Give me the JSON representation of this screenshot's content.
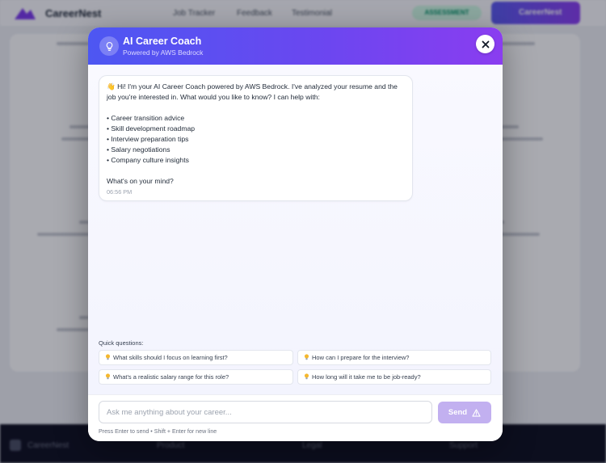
{
  "background": {
    "brand": "CareerNest",
    "nav_links": [
      "Job Tracker",
      "Feedback",
      "Testimonial"
    ],
    "status_badge": "ASSESSMENT",
    "cta_label": "CareerNest",
    "footer_brand": "CareerNest",
    "footer_headings": [
      "Product",
      "Legal",
      "Support"
    ]
  },
  "modal": {
    "title": "AI Career Coach",
    "subtitle": "Powered by AWS Bedrock",
    "close_icon": "close-icon",
    "header_icon": "lightbulb-icon"
  },
  "message": {
    "lines": [
      "👋 Hi! I'm your AI Career Coach powered by AWS Bedrock. I've analyzed your resume and the",
      "job you're interested in. What would you like to know? I can help with:",
      "• Career transition advice",
      "• Skill development roadmap",
      "• Interview preparation tips",
      "• Salary negotiations",
      "• Company culture insights",
      "What's on your mind?"
    ],
    "time": "06:56 PM"
  },
  "quick": {
    "label": "Quick questions:",
    "items": [
      "What skills should I focus on learning first?",
      "How can I prepare for the interview?",
      "What's a realistic salary range for this role?",
      "How long will it take me to be job-ready?"
    ]
  },
  "composer": {
    "placeholder": "Ask me anything about your career...",
    "value": "",
    "send_label": "Send",
    "hint": "Press Enter to send • Shift + Enter for new line"
  },
  "colors": {
    "header_start": "#4d57f2",
    "header_end": "#8a3df0",
    "send_button": "#c2b0f0",
    "bulb": "#f5b82e"
  }
}
